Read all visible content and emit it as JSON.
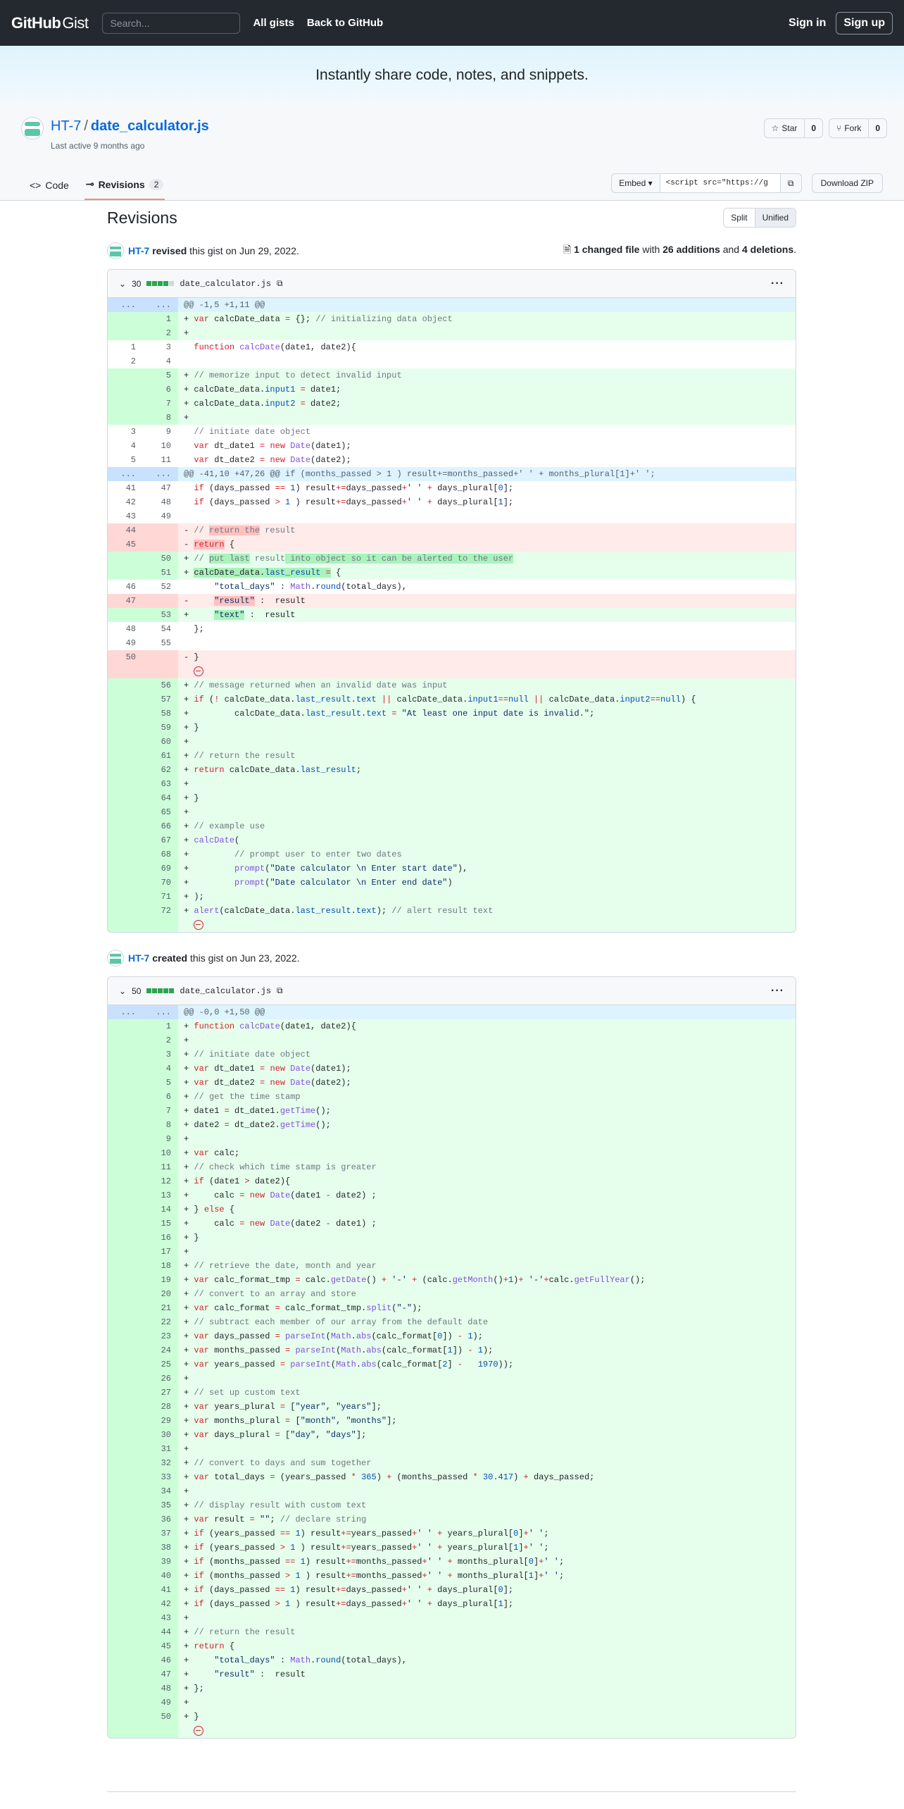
{
  "header": {
    "logo_github": "GitHub",
    "logo_gist": "Gist",
    "search_placeholder": "Search...",
    "nav": [
      "All gists",
      "Back to GitHub"
    ],
    "signin": "Sign in",
    "signup": "Sign up"
  },
  "banner": "Instantly share code, notes, and snippets.",
  "gist": {
    "owner": "HT-7",
    "sep": "/",
    "filename": "date_calculator.js",
    "last_active": "Last active 9 months ago",
    "star_label": "Star",
    "star_count": "0",
    "fork_label": "Fork",
    "fork_count": "0"
  },
  "tabs": {
    "code": "Code",
    "revisions": "Revisions",
    "revisions_count": "2"
  },
  "actions": {
    "embed": "Embed",
    "embed_url": "<script src=\"https://g",
    "download": "Download ZIP"
  },
  "page": {
    "title": "Revisions",
    "split": "Split",
    "unified": "Unified"
  },
  "revisions": [
    {
      "user": "HT-7",
      "verb": "revised",
      "rest": "this gist on Jun 29, 2022.",
      "summary_files": "1 changed file",
      "summary_with": "with",
      "summary_add": "26 additions",
      "summary_and": "and",
      "summary_del": "4 deletions",
      "file_count": "30",
      "filename": "date_calculator.js"
    },
    {
      "user": "HT-7",
      "verb": "created",
      "rest": "this gist on Jun 23, 2022.",
      "file_count": "50",
      "filename": "date_calculator.js"
    }
  ],
  "colors": {
    "add_bg": "#e6ffec",
    "del_bg": "#ffebe9",
    "hunk_bg": "#ddf4ff",
    "header_bg": "#24292f"
  }
}
